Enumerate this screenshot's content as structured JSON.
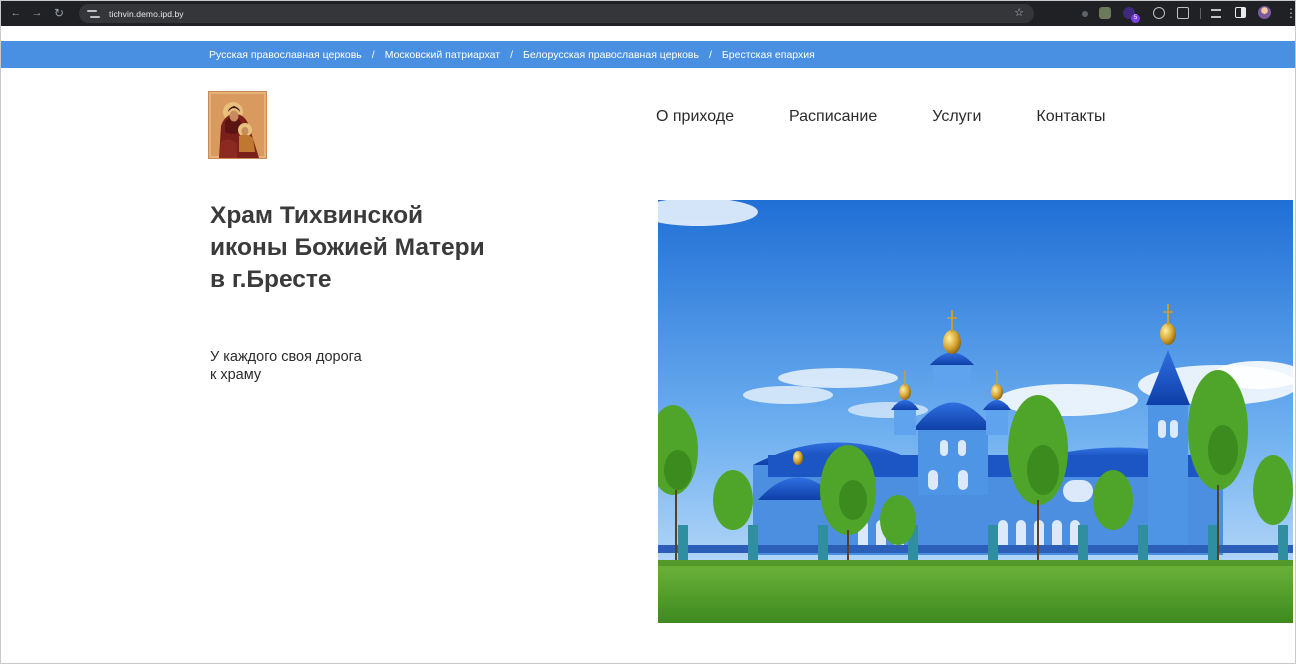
{
  "browser": {
    "url": "tichvin.demo.ipd.by",
    "extension_badge": "5"
  },
  "breadcrumb": {
    "items": [
      "Русская православная церковь",
      "Московский патриархат",
      "Белорусская православная церковь",
      "Брестская епархия"
    ],
    "separator": "/"
  },
  "nav": {
    "items": [
      "О приходе",
      "Расписание",
      "Услуги",
      "Контакты"
    ]
  },
  "hero": {
    "title_lines": [
      "Храм Тихвинской",
      "иконы Божией Матери",
      "в г.Бресте"
    ],
    "subtitle_lines": [
      "У каждого своя дорога",
      "к храму"
    ]
  },
  "icons": {
    "logo": "theotokos-icon-logo",
    "photo": "church-photo"
  },
  "colors": {
    "top_bar": "#4a90e2",
    "browser_bar": "#202124",
    "text": "#2b2b2b",
    "title": "#3a3a3a"
  }
}
